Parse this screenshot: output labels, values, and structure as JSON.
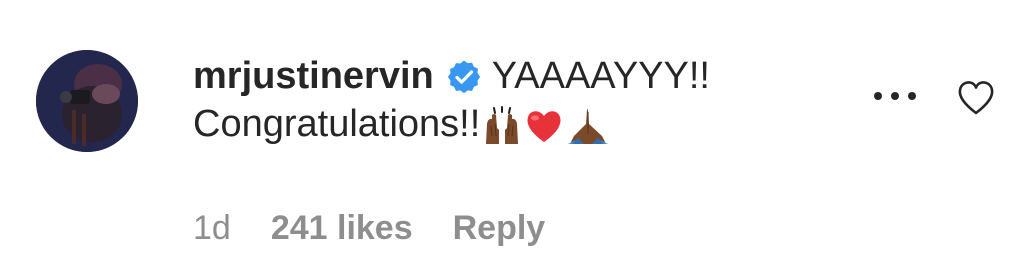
{
  "comment": {
    "username": "mrjustinervin",
    "verified_icon": "verified-badge-icon",
    "text_line1": "YAAAAYYY!!",
    "text_line2": "Congratulations!!",
    "emojis": [
      "raising-hands-emoji",
      "red-heart-emoji",
      "folded-hands-emoji"
    ],
    "time": "1d",
    "likes": "241 likes",
    "reply_label": "Reply",
    "more_icon": "more-options-icon",
    "like_icon": "heart-outline-icon"
  },
  "colors": {
    "text": "#262626",
    "secondary": "#8e8e8e",
    "verified": "#3897f0"
  }
}
